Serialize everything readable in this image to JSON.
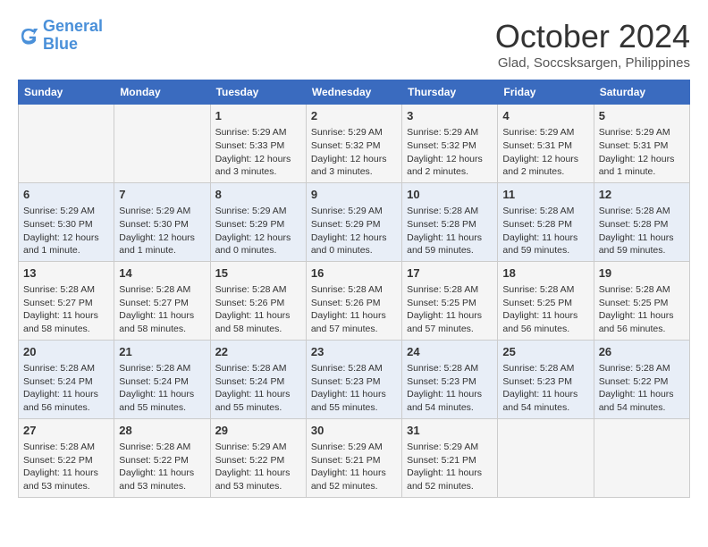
{
  "header": {
    "logo_line1": "General",
    "logo_line2": "Blue",
    "month": "October 2024",
    "location": "Glad, Soccsksargen, Philippines"
  },
  "weekdays": [
    "Sunday",
    "Monday",
    "Tuesday",
    "Wednesday",
    "Thursday",
    "Friday",
    "Saturday"
  ],
  "weeks": [
    [
      {
        "day": "",
        "info": ""
      },
      {
        "day": "",
        "info": ""
      },
      {
        "day": "1",
        "info": "Sunrise: 5:29 AM\nSunset: 5:33 PM\nDaylight: 12 hours and 3 minutes."
      },
      {
        "day": "2",
        "info": "Sunrise: 5:29 AM\nSunset: 5:32 PM\nDaylight: 12 hours and 3 minutes."
      },
      {
        "day": "3",
        "info": "Sunrise: 5:29 AM\nSunset: 5:32 PM\nDaylight: 12 hours and 2 minutes."
      },
      {
        "day": "4",
        "info": "Sunrise: 5:29 AM\nSunset: 5:31 PM\nDaylight: 12 hours and 2 minutes."
      },
      {
        "day": "5",
        "info": "Sunrise: 5:29 AM\nSunset: 5:31 PM\nDaylight: 12 hours and 1 minute."
      }
    ],
    [
      {
        "day": "6",
        "info": "Sunrise: 5:29 AM\nSunset: 5:30 PM\nDaylight: 12 hours and 1 minute."
      },
      {
        "day": "7",
        "info": "Sunrise: 5:29 AM\nSunset: 5:30 PM\nDaylight: 12 hours and 1 minute."
      },
      {
        "day": "8",
        "info": "Sunrise: 5:29 AM\nSunset: 5:29 PM\nDaylight: 12 hours and 0 minutes."
      },
      {
        "day": "9",
        "info": "Sunrise: 5:29 AM\nSunset: 5:29 PM\nDaylight: 12 hours and 0 minutes."
      },
      {
        "day": "10",
        "info": "Sunrise: 5:28 AM\nSunset: 5:28 PM\nDaylight: 11 hours and 59 minutes."
      },
      {
        "day": "11",
        "info": "Sunrise: 5:28 AM\nSunset: 5:28 PM\nDaylight: 11 hours and 59 minutes."
      },
      {
        "day": "12",
        "info": "Sunrise: 5:28 AM\nSunset: 5:28 PM\nDaylight: 11 hours and 59 minutes."
      }
    ],
    [
      {
        "day": "13",
        "info": "Sunrise: 5:28 AM\nSunset: 5:27 PM\nDaylight: 11 hours and 58 minutes."
      },
      {
        "day": "14",
        "info": "Sunrise: 5:28 AM\nSunset: 5:27 PM\nDaylight: 11 hours and 58 minutes."
      },
      {
        "day": "15",
        "info": "Sunrise: 5:28 AM\nSunset: 5:26 PM\nDaylight: 11 hours and 58 minutes."
      },
      {
        "day": "16",
        "info": "Sunrise: 5:28 AM\nSunset: 5:26 PM\nDaylight: 11 hours and 57 minutes."
      },
      {
        "day": "17",
        "info": "Sunrise: 5:28 AM\nSunset: 5:25 PM\nDaylight: 11 hours and 57 minutes."
      },
      {
        "day": "18",
        "info": "Sunrise: 5:28 AM\nSunset: 5:25 PM\nDaylight: 11 hours and 56 minutes."
      },
      {
        "day": "19",
        "info": "Sunrise: 5:28 AM\nSunset: 5:25 PM\nDaylight: 11 hours and 56 minutes."
      }
    ],
    [
      {
        "day": "20",
        "info": "Sunrise: 5:28 AM\nSunset: 5:24 PM\nDaylight: 11 hours and 56 minutes."
      },
      {
        "day": "21",
        "info": "Sunrise: 5:28 AM\nSunset: 5:24 PM\nDaylight: 11 hours and 55 minutes."
      },
      {
        "day": "22",
        "info": "Sunrise: 5:28 AM\nSunset: 5:24 PM\nDaylight: 11 hours and 55 minutes."
      },
      {
        "day": "23",
        "info": "Sunrise: 5:28 AM\nSunset: 5:23 PM\nDaylight: 11 hours and 55 minutes."
      },
      {
        "day": "24",
        "info": "Sunrise: 5:28 AM\nSunset: 5:23 PM\nDaylight: 11 hours and 54 minutes."
      },
      {
        "day": "25",
        "info": "Sunrise: 5:28 AM\nSunset: 5:23 PM\nDaylight: 11 hours and 54 minutes."
      },
      {
        "day": "26",
        "info": "Sunrise: 5:28 AM\nSunset: 5:22 PM\nDaylight: 11 hours and 54 minutes."
      }
    ],
    [
      {
        "day": "27",
        "info": "Sunrise: 5:28 AM\nSunset: 5:22 PM\nDaylight: 11 hours and 53 minutes."
      },
      {
        "day": "28",
        "info": "Sunrise: 5:28 AM\nSunset: 5:22 PM\nDaylight: 11 hours and 53 minutes."
      },
      {
        "day": "29",
        "info": "Sunrise: 5:29 AM\nSunset: 5:22 PM\nDaylight: 11 hours and 53 minutes."
      },
      {
        "day": "30",
        "info": "Sunrise: 5:29 AM\nSunset: 5:21 PM\nDaylight: 11 hours and 52 minutes."
      },
      {
        "day": "31",
        "info": "Sunrise: 5:29 AM\nSunset: 5:21 PM\nDaylight: 11 hours and 52 minutes."
      },
      {
        "day": "",
        "info": ""
      },
      {
        "day": "",
        "info": ""
      }
    ]
  ]
}
